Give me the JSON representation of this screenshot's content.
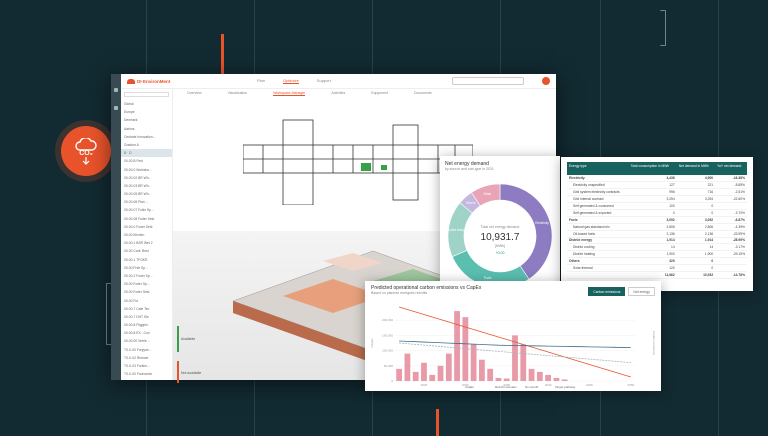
{
  "app": {
    "brand": "DI·EnvironMent",
    "nav": [
      "Plan",
      "Optimize",
      "Support"
    ],
    "nav_active": 1,
    "tabs": [
      "Overview",
      "Visualization",
      "Workspace Manager",
      "Activities",
      "Equipment",
      "Documents"
    ],
    "tab_active": 2
  },
  "tree": [
    "Global",
    "Europe",
    "Denmark",
    "Aarhus",
    "Centrale Innovation...",
    "Gradum A",
    "B · D",
    "00-00 B Fest",
    "00-00-0 Workshu...",
    "00-00-02 BR Wh...",
    "00-00-03 BR Wh...",
    "00-00-05 BR Wh...",
    "00-00-06 Plan ...",
    "00-00-07 Folkv Sp...",
    "00-00-08 Foder Sest",
    "00-00-0 Foder Sest",
    "00-00 Kitchen",
    "00-00-1 BSR Wet 2",
    "00-00 Conf. Best",
    "00-00-1 TFOKR",
    "00-00 Frsfr Sp...",
    "00-00-2 Foder Sp...",
    "00-00 Foder Sp...",
    "00-00 Foder Sest",
    "00-00 Fut",
    "00-00-7 Cafe Tec",
    "00-00-7 DHT Sle",
    "00-00-8 Fligppln",
    "00-00-8 EX - Con",
    "00-00-00 Verrie ...",
    "TX-0-00 Foryyee...",
    "TX-0-02 Remoer",
    "TX-0-03 Fontim...",
    "TX-0-00 Foonscher",
    "TX-0-04 Cons Nu...",
    "TX-00 Sest Bor"
  ],
  "legend": {
    "available": "Available",
    "not_available": "Not available"
  },
  "badge": {
    "label": "CO₂",
    "accent": "#e8532b"
  },
  "energy": {
    "title": "Net energy demand",
    "subtitle": "by source and sub-type in 2021",
    "center_label": "Total net energy demand",
    "value": "10,931.7",
    "unit": "[MWh]",
    "delta": "+0.00",
    "segments": [
      {
        "name": "Electricity",
        "value": 4436,
        "color": "#8e7cc3"
      },
      {
        "name": "Fuels",
        "value": 3052,
        "color": "#5bbfb0"
      },
      {
        "name": "District energy",
        "value": 1914,
        "color": "#9fd3c7"
      },
      {
        "name": "Others",
        "value": 520,
        "color": "#c4b7e0"
      },
      {
        "name": "Solar",
        "value": 1010,
        "color": "#e9a5b5"
      }
    ]
  },
  "table": {
    "headers": [
      "Energy type",
      "Total consumption in MWh",
      "Net demand in MWh",
      "YoY net demand"
    ],
    "rows": [
      {
        "c": [
          "Electricity",
          "4,436",
          "4,900",
          "-16.38%"
        ],
        "b": true
      },
      {
        "c": [
          "Electricity unspecified",
          "127",
          "221",
          "-8.85%"
        ]
      },
      {
        "c": [
          "Grid system electricity contracts",
          "996",
          "716",
          "-2.51%"
        ]
      },
      {
        "c": [
          "Grid internal contract",
          "3,254",
          "3,254",
          "-22.60%"
        ]
      },
      {
        "c": [
          "Self generated & consumed",
          "100",
          "0",
          ""
        ]
      },
      {
        "c": [
          "Self generated & exported",
          "0",
          "0",
          "-3.70%"
        ]
      },
      {
        "c": [
          "Fuels",
          "3,052",
          "3,052",
          "-6.87%"
        ],
        "b": true
      },
      {
        "c": [
          "Natural gas standard mix",
          "2,806",
          "2,806",
          "-4.39%"
        ]
      },
      {
        "c": [
          "Oil-based fuels",
          "2,136",
          "2,136",
          "-23.99%"
        ]
      },
      {
        "c": [
          "District energy",
          "1,914",
          "1,914",
          "-28.99%"
        ],
        "b": true
      },
      {
        "c": [
          "District cooling",
          "14",
          "14",
          "-3.17%"
        ]
      },
      {
        "c": [
          "District heating",
          "1,900",
          "1,900",
          "-29.15%"
        ]
      },
      {
        "c": [
          "Others",
          "320",
          "0",
          ""
        ],
        "b": true
      },
      {
        "c": [
          "Solar thermal",
          "120",
          "0",
          ""
        ]
      },
      {
        "c": [
          "",
          "11,662",
          "10,932",
          "-14.78%"
        ],
        "b": true
      }
    ]
  },
  "chart_data": {
    "type": "bar",
    "title": "Predicted operational carbon emissions vs CapEx",
    "subtitle": "Based on planned energetic retrofits",
    "buttons": [
      "Carbon emissions",
      "Net energy"
    ],
    "x": [
      2022,
      2023,
      2024,
      2025,
      2026,
      2027,
      2028,
      2029,
      2030,
      2031,
      2032,
      2033,
      2034,
      2035,
      2036,
      2037,
      2038,
      2039,
      2040,
      2041,
      2042,
      2043,
      2044,
      2045,
      2046,
      2047,
      2048,
      2049,
      2050
    ],
    "xticks": [
      "2025",
      "2030",
      "2035",
      "2040",
      "2045",
      "2050"
    ],
    "yticks_left": [
      "0",
      "50,000",
      "100,000",
      "150,000",
      "200,000"
    ],
    "capex": [
      40000,
      90000,
      30000,
      60000,
      20000,
      50000,
      90000,
      230000,
      210000,
      120000,
      70000,
      40000,
      10000,
      8000,
      150000,
      120000,
      40000,
      30000,
      20000,
      10000,
      5000,
      0,
      0,
      0,
      0,
      0,
      0,
      0,
      0
    ],
    "legend": [
      "CapEx",
      "Retrofit scenario",
      "No retrofit",
      "Target pathway"
    ],
    "ylabel_left": "CapEx",
    "ylabel_right": "Carbon emissions"
  }
}
